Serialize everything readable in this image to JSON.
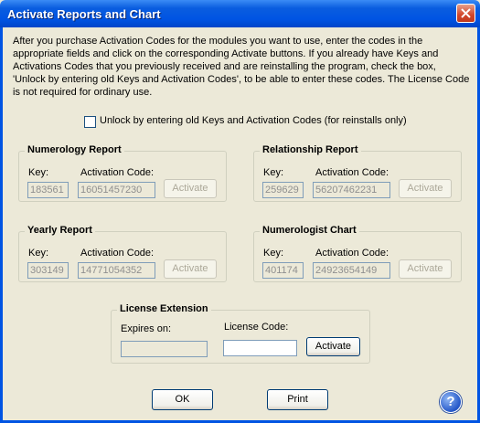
{
  "window": {
    "title": "Activate Reports and Chart"
  },
  "intro": "After you purchase Activation Codes for the modules you want to use, enter the codes in the appropriate fields and click on the corresponding Activate buttons. If you already have Keys and Activations Codes that you previously received and are reinstalling the program, check the box, 'Unlock by entering old Keys and Activation Codes', to be able to enter these codes. The License Code is not required for ordinary use.",
  "unlock_checkbox": {
    "label": "Unlock by entering old Keys and Activation Codes (for reinstalls only)",
    "checked": false
  },
  "labels": {
    "key": "Key:",
    "activation_code": "Activation Code:",
    "activate": "Activate"
  },
  "modules": {
    "numerology_report": {
      "title": "Numerology Report",
      "key": "183561",
      "code": "16051457230"
    },
    "relationship_report": {
      "title": "Relationship Report",
      "key": "259629",
      "code": "56207462231"
    },
    "yearly_report": {
      "title": "Yearly Report",
      "key": "303149",
      "code": "14771054352"
    },
    "numerologist_chart": {
      "title": "Numerologist Chart",
      "key": "401174",
      "code": "24923654149"
    }
  },
  "license": {
    "title": "License Extension",
    "expires_label": "Expires on:",
    "expires_value": "",
    "code_label": "License Code:",
    "code_value": "",
    "activate": "Activate"
  },
  "buttons": {
    "ok": "OK",
    "print": "Print",
    "help": "?"
  }
}
